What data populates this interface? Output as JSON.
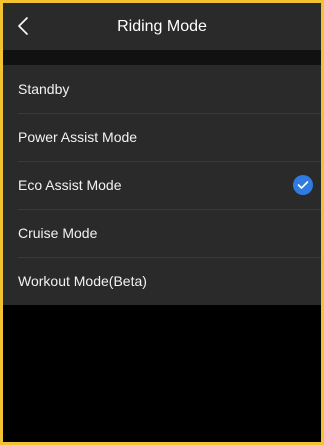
{
  "header": {
    "title": "Riding Mode",
    "back_icon": "chevron-left-icon"
  },
  "modes": [
    {
      "label": "Standby",
      "selected": false
    },
    {
      "label": "Power Assist Mode",
      "selected": false
    },
    {
      "label": "Eco Assist Mode",
      "selected": true
    },
    {
      "label": "Cruise Mode",
      "selected": false
    },
    {
      "label": "Workout Mode(Beta)",
      "selected": false
    }
  ],
  "selected_icon": "checkmark-circle-icon",
  "colors": {
    "accent": "#2f7be0",
    "frame_border": "#f2c230",
    "panel": "#2a2a2a",
    "background": "#000000"
  }
}
